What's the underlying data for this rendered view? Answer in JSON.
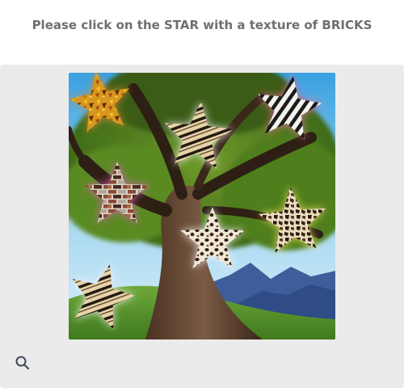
{
  "prompt": {
    "text": "Please click on the STAR with a texture of BRICKS"
  },
  "stars": [
    {
      "texture": "autumn-leaves"
    },
    {
      "texture": "tiger-stripes"
    },
    {
      "texture": "zebra-stripes"
    },
    {
      "texture": "bricks"
    },
    {
      "texture": "leopard-spots"
    },
    {
      "texture": "giraffe-spots"
    },
    {
      "texture": "tiger-stripes"
    }
  ],
  "toolbar": {
    "search_icon": "magnifier-icon"
  },
  "colors": {
    "prompt_text": "#6f6f6f",
    "panel_bg": "#ebebeb",
    "icon": "#3f4a5a"
  }
}
